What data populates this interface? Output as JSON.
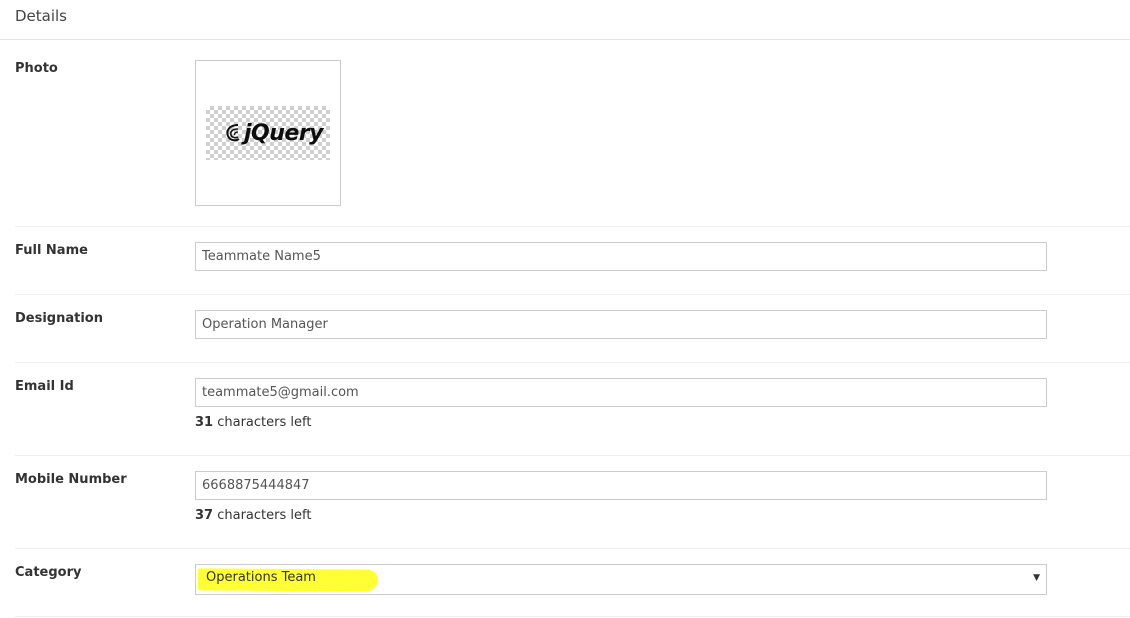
{
  "header": {
    "title": "Details"
  },
  "photo": {
    "label": "Photo",
    "logo_text": "jQuery",
    "logo_icon": "jquery-swoosh-icon"
  },
  "full_name": {
    "label": "Full Name",
    "value": "Teammate Name5"
  },
  "designation": {
    "label": "Designation",
    "value": "Operation Manager"
  },
  "email": {
    "label": "Email Id",
    "value": "teammate5@gmail.com",
    "chars_left": "31",
    "chars_left_suffix": " characters left"
  },
  "mobile": {
    "label": "Mobile Number",
    "value": "6668875444847",
    "chars_left": "37",
    "chars_left_suffix": " characters left"
  },
  "category": {
    "label": "Category",
    "selected": "Operations Team",
    "highlight_color": "#ffff33",
    "caret_glyph": "▼"
  }
}
